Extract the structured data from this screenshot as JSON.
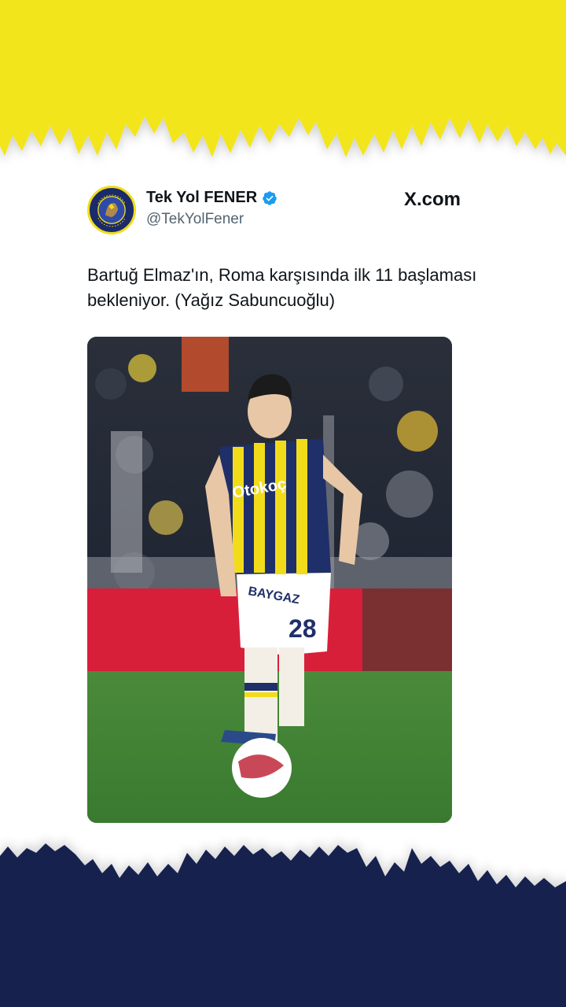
{
  "tweet": {
    "display_name": "Tek Yol FENER",
    "handle": "@TekYolFener",
    "source_label": "X.com",
    "text": "Bartuğ Elmaz'ın, Roma karşısında ilk 11 başlaması bekleniyor. (Yağız Sabuncuoğlu)",
    "verified_icon": "verified-badge-icon",
    "avatar_icon": "club-crest-avatar"
  },
  "photo": {
    "jersey_sponsor": "Otokoç",
    "shorts_sponsor": "BAYGAZ",
    "shirt_number": "28"
  },
  "colors": {
    "top_band": "#f2e51c",
    "bottom_band": "#15224e",
    "verified": "#1d9bf0",
    "text_primary": "#0f1419",
    "text_secondary": "#536471"
  }
}
